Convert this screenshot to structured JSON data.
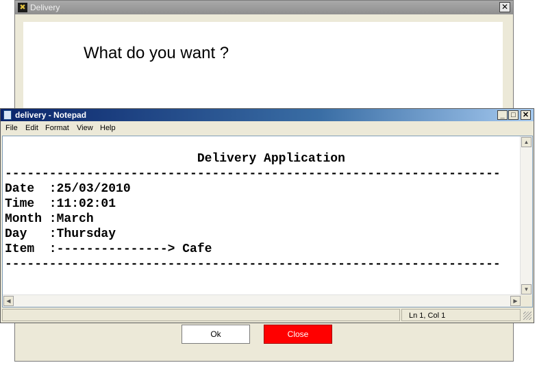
{
  "delivery_window": {
    "title": "Delivery",
    "close_glyph": "✕",
    "icon": "cross-icon",
    "question": "What do you want ?",
    "ok_label": "Ok",
    "close_label": "Close",
    "close_button_color": "#ff0000"
  },
  "notepad": {
    "title": "delivery - Notepad",
    "icon": "notepad-icon",
    "controls": {
      "minimize": "_",
      "maximize": "□",
      "close": "✕"
    },
    "menu": [
      "File",
      "Edit",
      "Format",
      "View",
      "Help"
    ],
    "content": "                          Delivery Application\n-------------------------------------------------------------------\nDate  :25/03/2010\nTime  :11:02:01\nMonth :March\nDay   :Thursday\nItem  :---------------> Cafe\n-------------------------------------------------------------------",
    "status": {
      "position": "Ln 1, Col 1"
    },
    "titlebar_color": "#0a246a"
  }
}
